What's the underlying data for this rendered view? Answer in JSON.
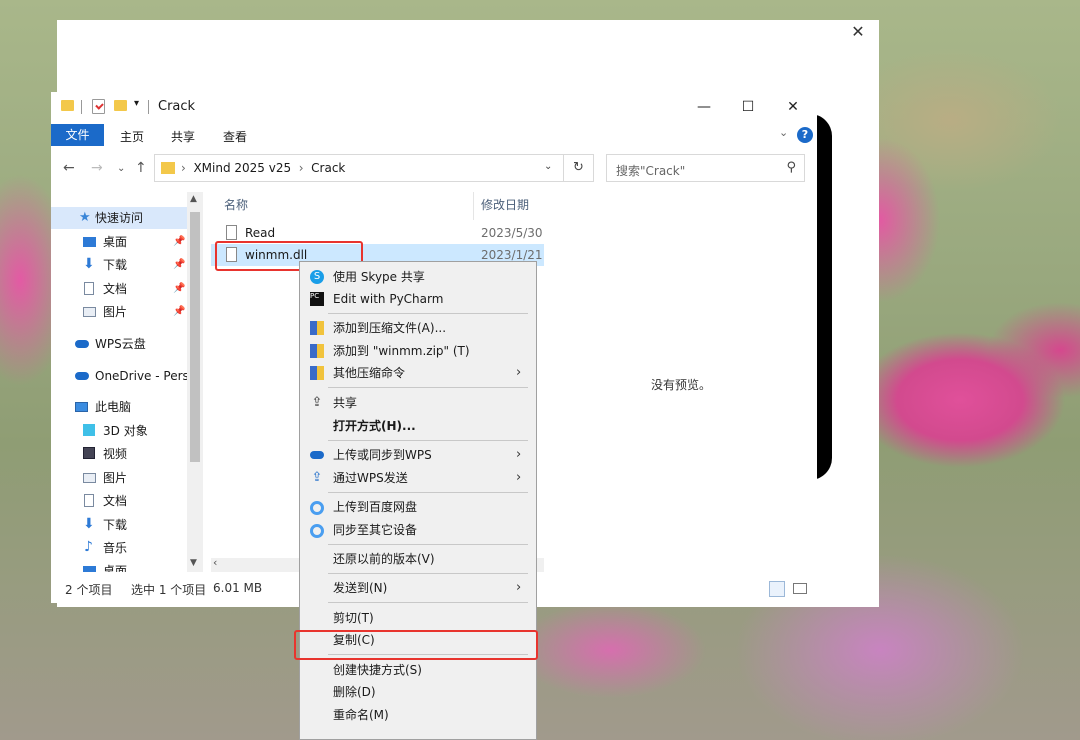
{
  "explorer": {
    "title": "Crack",
    "ribbon": {
      "file": "文件",
      "home": "主页",
      "share": "共享",
      "view": "查看"
    },
    "address": {
      "crumbs": [
        "XMind 2025 v25",
        "Crack"
      ],
      "search_placeholder": "搜索\"Crack\""
    },
    "nav_pane": [
      {
        "label": "快速访问",
        "icon": "star-icon",
        "pinned": false
      },
      {
        "label": "桌面",
        "icon": "desktop-icon",
        "pinned": true
      },
      {
        "label": "下载",
        "icon": "download-icon",
        "pinned": true
      },
      {
        "label": "文档",
        "icon": "document-icon",
        "pinned": true
      },
      {
        "label": "图片",
        "icon": "pictures-icon",
        "pinned": true
      },
      {
        "label": "WPS云盘",
        "icon": "cloud-icon",
        "pinned": false
      },
      {
        "label": "OneDrive - Perso",
        "icon": "onedrive-icon",
        "pinned": false
      },
      {
        "label": "此电脑",
        "icon": "computer-icon",
        "pinned": false
      },
      {
        "label": "3D 对象",
        "icon": "cube-icon",
        "pinned": false
      },
      {
        "label": "视频",
        "icon": "video-icon",
        "pinned": false
      },
      {
        "label": "图片",
        "icon": "pictures-icon",
        "pinned": false
      },
      {
        "label": "文档",
        "icon": "document-icon",
        "pinned": false
      },
      {
        "label": "下载",
        "icon": "download-icon",
        "pinned": false
      },
      {
        "label": "音乐",
        "icon": "music-icon",
        "pinned": false
      },
      {
        "label": "桌面",
        "icon": "desktop-icon",
        "pinned": false
      }
    ],
    "columns": {
      "name": "名称",
      "modified": "修改日期"
    },
    "files": [
      {
        "name": "Read",
        "date": "2023/5/30",
        "selected": false
      },
      {
        "name": "winmm.dll",
        "date": "2023/1/21",
        "selected": true
      }
    ],
    "preview": "没有预览。",
    "status": {
      "count": "2 个项目",
      "selected": "选中 1 个项目",
      "size": "6.01 MB"
    }
  },
  "context_menu": {
    "items": [
      {
        "label": "使用 Skype 共享",
        "icon": "skype-icon",
        "submenu": false
      },
      {
        "label": "Edit with PyCharm",
        "icon": "pycharm-icon",
        "submenu": false
      },
      {
        "label": "添加到压缩文件(A)...",
        "icon": "archive-icon",
        "submenu": false
      },
      {
        "label": "添加到 \"winmm.zip\" (T)",
        "icon": "archive-icon",
        "submenu": false
      },
      {
        "label": "其他压缩命令",
        "icon": "archive-icon",
        "submenu": true
      },
      {
        "label": "共享",
        "icon": "share-icon",
        "submenu": false
      },
      {
        "label": "打开方式(H)...",
        "icon": "",
        "submenu": false,
        "bold": true
      },
      {
        "label": "上传或同步到WPS",
        "icon": "wps-cloud-icon",
        "submenu": true
      },
      {
        "label": "通过WPS发送",
        "icon": "wps-send-icon",
        "submenu": true
      },
      {
        "label": "上传到百度网盘",
        "icon": "baidu-icon",
        "submenu": false
      },
      {
        "label": "同步至其它设备",
        "icon": "baidu-icon",
        "submenu": false
      },
      {
        "label": "还原以前的版本(V)",
        "icon": "",
        "submenu": false
      },
      {
        "label": "发送到(N)",
        "icon": "",
        "submenu": true
      },
      {
        "label": "剪切(T)",
        "icon": "",
        "submenu": false
      },
      {
        "label": "复制(C)",
        "icon": "",
        "submenu": false
      },
      {
        "label": "创建快捷方式(S)",
        "icon": "",
        "submenu": false
      },
      {
        "label": "删除(D)",
        "icon": "",
        "submenu": false
      },
      {
        "label": "重命名(M)",
        "icon": "",
        "submenu": false
      }
    ]
  },
  "colors": {
    "accent": "#1b6ac9",
    "highlight": "#e8342e",
    "selection": "#cce8ff"
  }
}
